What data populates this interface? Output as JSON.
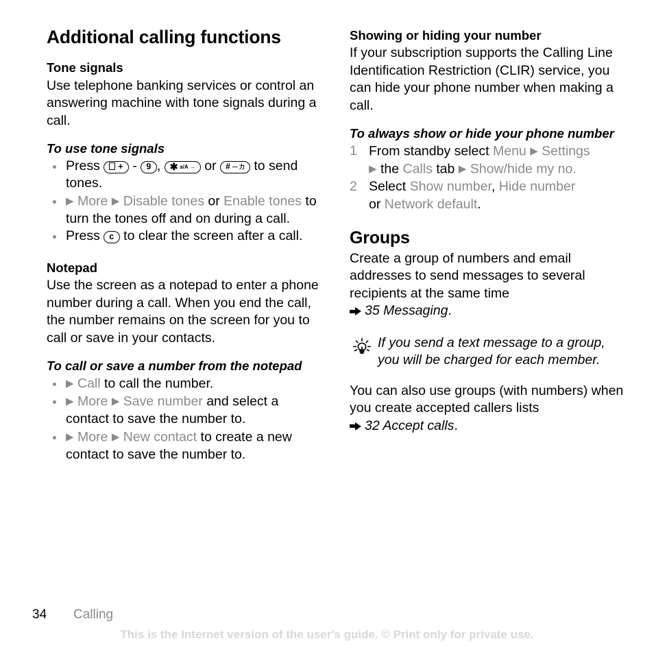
{
  "document": {
    "chapter_title": "Additional calling functions",
    "page_number": "34",
    "footer_chapter": "Calling",
    "watermark": "This is the Internet version of the user's guide. © Print only for private use."
  },
  "left_column": {
    "tone_signals": {
      "heading": "Tone signals",
      "body": "Use telephone banking services or control an answering machine with tone signals during a call.",
      "procedure_title": "To use tone signals",
      "bullets": {
        "b1_press": "Press",
        "b1_key_zero": "0 +",
        "b1_dash": "-",
        "b1_key_nine": "9",
        "b1_comma": ",",
        "b1_key_star": "*",
        "b1_or": "or",
        "b1_key_hash": "#",
        "b1_tail": "to send tones.",
        "b2_more": "More",
        "b2_disable": "Disable tones",
        "b2_or": "or",
        "b2_enable": "Enable tones",
        "b2_tail": "to turn the tones off and on during a call.",
        "b3_press": "Press",
        "b3_key_c": "c",
        "b3_tail": "to clear the screen after a call."
      }
    },
    "notepad": {
      "heading": "Notepad",
      "body": "Use the screen as a notepad to enter a phone number during a call. When you end the call, the number remains on the screen for you to call or save in your contacts.",
      "procedure_title": "To call or save a number from the notepad",
      "bullets": {
        "b1_call": "Call",
        "b1_tail": "to call the number.",
        "b2_more": "More",
        "b2_save": "Save number",
        "b2_tail": "and select a contact to save the number to.",
        "b3_more": "More",
        "b3_new": "New contact",
        "b3_tail": "to create a new contact to save the number to."
      }
    }
  },
  "right_column": {
    "showing_hiding": {
      "heading": "Showing or hiding your number",
      "body": "If your subscription supports the Calling Line Identification Restriction (CLIR) service, you can hide your phone number when making a call.",
      "procedure_title": "To always show or hide your phone number",
      "steps": [
        {
          "num": "1",
          "lead": "From standby select",
          "ui_menu": "Menu",
          "ui_settings": "Settings",
          "the": "the",
          "ui_calls": "Calls",
          "tab": "tab",
          "ui_showhide": "Show/hide my no."
        },
        {
          "num": "2",
          "lead": "Select",
          "ui_show": "Show number",
          "comma": ",",
          "ui_hide": "Hide number",
          "or": "or",
          "ui_network": "Network default",
          "period": "."
        }
      ]
    },
    "groups": {
      "heading": "Groups",
      "body": "Create a group of numbers and email addresses to send messages to several recipients at the same time",
      "ref_1": "35 Messaging",
      "ref_1_period": ".",
      "tip": "If you send a text message to a group, you will be charged for each member.",
      "body_2": "You can also use groups (with numbers) when you create accepted callers lists",
      "ref_2": "32 Accept calls",
      "ref_2_period": "."
    }
  }
}
